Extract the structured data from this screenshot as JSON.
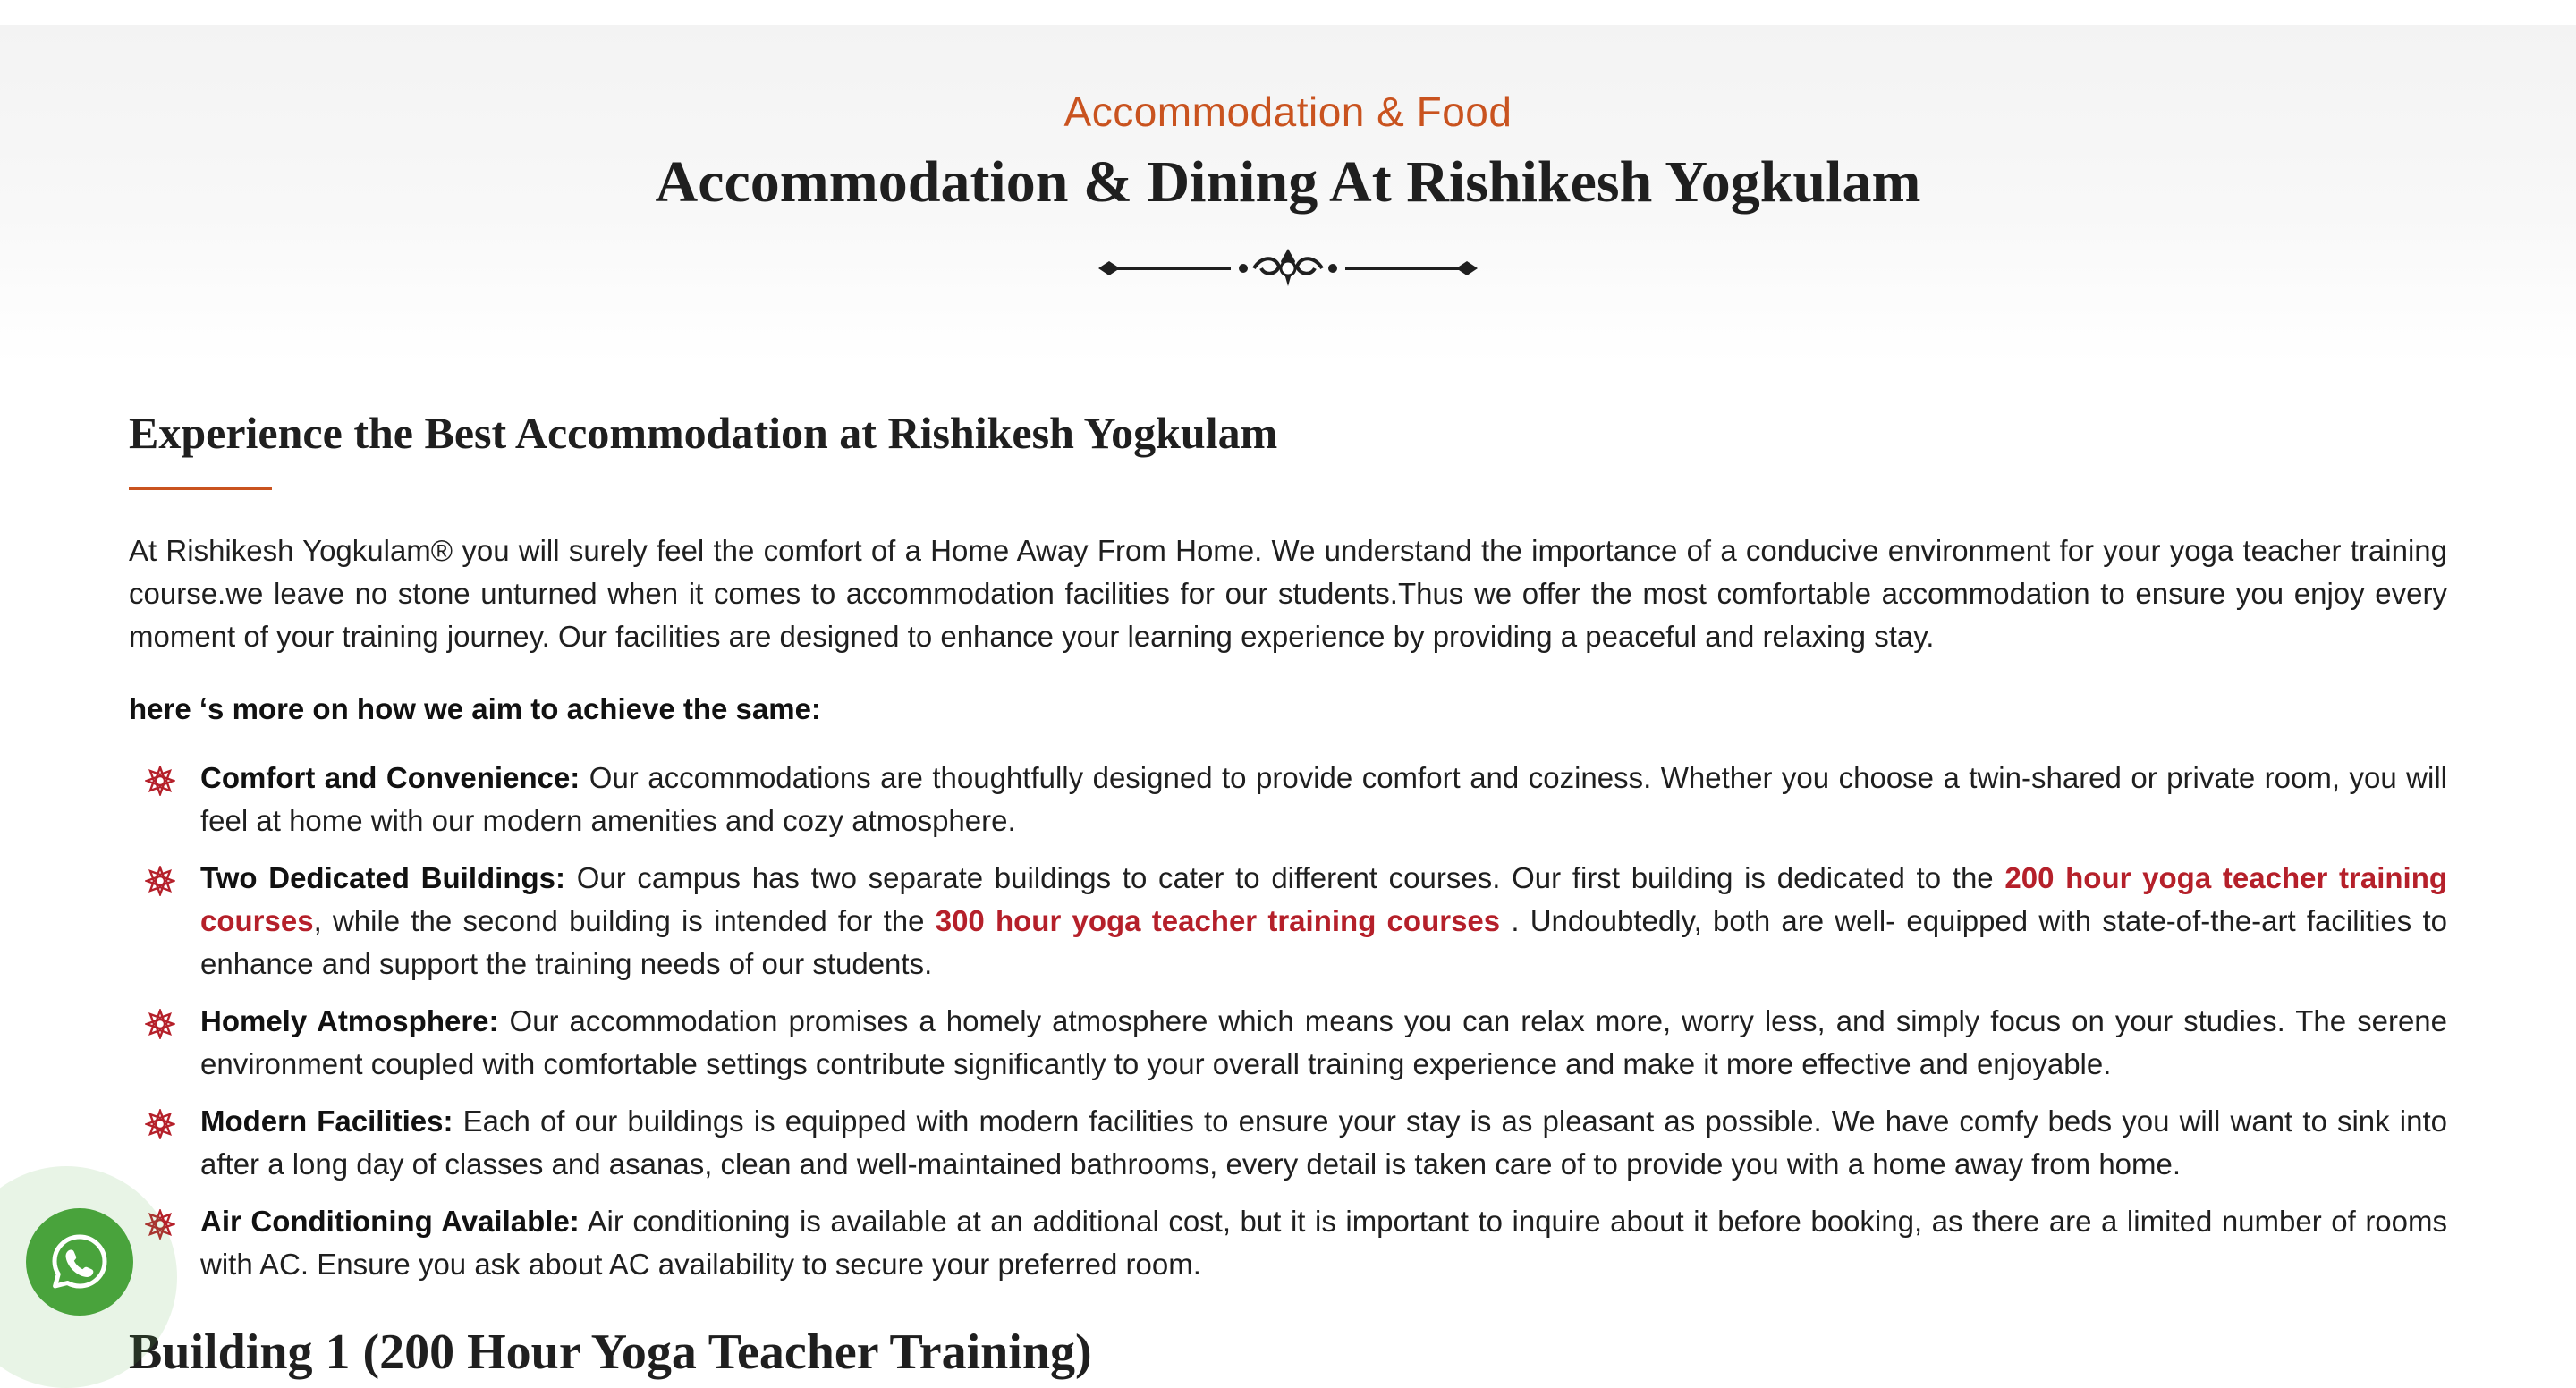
{
  "header": {
    "eyebrow": "Accommodation & Food",
    "title": "Accommodation & Dining At Rishikesh Yogkulam"
  },
  "section": {
    "title": "Experience the Best Accommodation at Rishikesh Yogkulam",
    "intro": "At Rishikesh Yogkulam® you will surely feel the comfort of a Home Away From Home. We understand the importance of a conducive environment for your yoga teacher training course.we leave no stone unturned when it comes to accommodation facilities for our students.Thus we offer the most comfortable accommodation to ensure you enjoy every moment of your training journey. Our facilities are designed to enhance your learning experience by providing a peaceful and relaxing stay.",
    "lead": "here ‘s more on how we aim to achieve the same:"
  },
  "features": [
    {
      "title": "Comfort and Convenience:",
      "text": " Our accommodations are thoughtfully designed to provide comfort and coziness. Whether you choose a twin-shared or private room, you will feel at home with our modern amenities and cozy atmosphere."
    },
    {
      "title": "Two Dedicated Buildings:",
      "text_before": " Our campus has two separate buildings to cater to different courses. Our first building is dedicated to the ",
      "link1": "200 hour yoga teacher training courses",
      "text_middle": ", while the second building is intended for the ",
      "link2": "300 hour yoga teacher training courses",
      "text_after": " . Undoubtedly, both are well- equipped with state-of-the-art facilities to enhance and support the training needs of our students."
    },
    {
      "title": "Homely Atmosphere:",
      "text": " Our accommodation promises a homely atmosphere which means you can relax more, worry less, and simply focus on your studies. The serene environment coupled with comfortable settings contribute significantly to your overall training experience and make it more effective and enjoyable."
    },
    {
      "title": "Modern Facilities:",
      "text": " Each of our buildings is equipped with modern facilities to ensure your stay is as pleasant as possible. We have comfy beds you will want to sink into after a long day of classes and asanas, clean and well-maintained bathrooms, every detail is taken care of to provide you with a home away from home."
    },
    {
      "title": "Air Conditioning Available:",
      "text": " Air conditioning is available at an additional cost, but it is important to inquire about it before booking, as there are a limited number of rooms with AC. Ensure you ask about AC availability to secure your preferred room."
    }
  ],
  "next_section": {
    "title": "Building 1 (200 Hour Yoga Teacher Training)"
  },
  "icons": {
    "bullet": "mandala-icon",
    "whatsapp": "whatsapp-icon",
    "divider": "ornament-divider-icon"
  },
  "colors": {
    "accent": "#c9531f",
    "link": "#b5202a",
    "whatsapp": "#49a33c"
  }
}
